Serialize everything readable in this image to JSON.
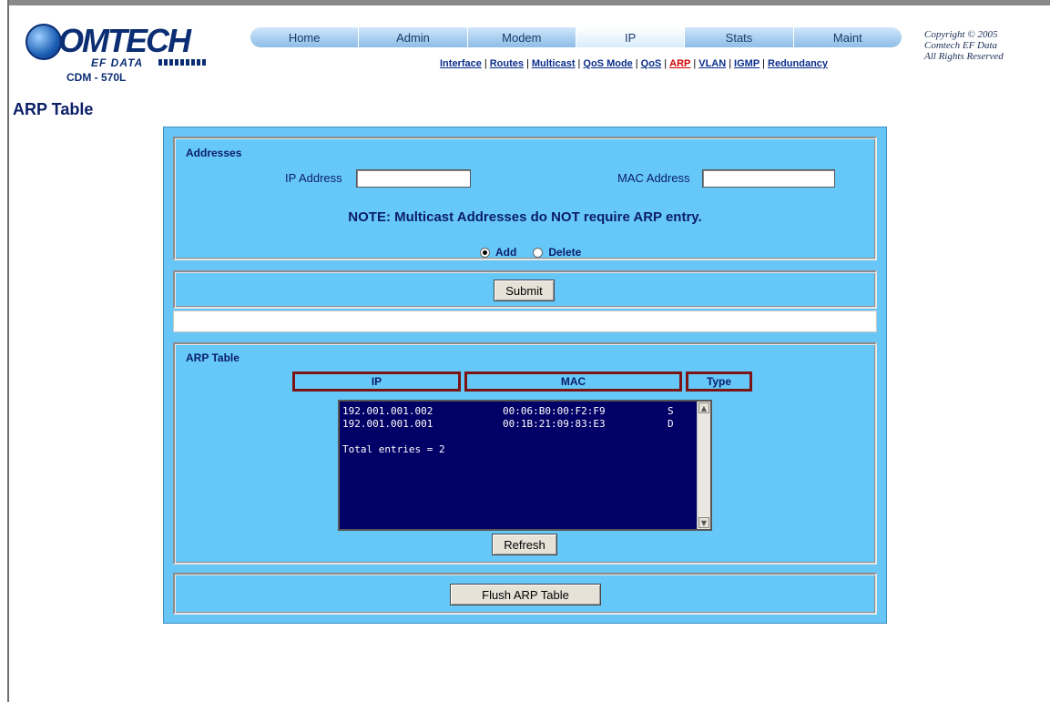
{
  "brand": {
    "logo_word": "OMTECH",
    "logo_sub": "EF DATA",
    "model": "CDM - 570L"
  },
  "nav": {
    "tabs": [
      "Home",
      "Admin",
      "Modem",
      "IP",
      "Stats",
      "Maint"
    ],
    "active": "IP"
  },
  "subnav": {
    "items": [
      "Interface",
      "Routes",
      "Multicast",
      "QoS Mode",
      "QoS",
      "ARP",
      "VLAN",
      "IGMP",
      "Redundancy"
    ],
    "active": "ARP"
  },
  "copyright": {
    "line1": "Copyright © 2005",
    "line2": "Comtech EF Data",
    "line3": "All Rights Reserved"
  },
  "page_title": "ARP Table",
  "addresses": {
    "title": "Addresses",
    "ip_label": "IP Address",
    "ip_value": "",
    "mac_label": "MAC Address",
    "mac_value": "",
    "note": "NOTE: Multicast Addresses do NOT require ARP entry.",
    "add_label": "Add",
    "delete_label": "Delete",
    "selected": "Add",
    "submit_label": "Submit"
  },
  "arp_table": {
    "title": "ARP Table",
    "columns": [
      "IP",
      "MAC",
      "Type"
    ],
    "rows": [
      {
        "ip": "192.001.001.002",
        "mac": "00:06:B0:00:F2:F9",
        "type": "S"
      },
      {
        "ip": "192.001.001.001",
        "mac": "00:1B:21:09:83:E3",
        "type": "D"
      }
    ],
    "total_text": "Total entries = 2",
    "refresh_label": "Refresh",
    "flush_label": "Flush ARP Table"
  },
  "colors": {
    "panel": "#67c6f5",
    "list_bg": "#000066",
    "header_border": "#7b1414",
    "title_text": "#0b1e66",
    "active_link": "#d40000"
  }
}
